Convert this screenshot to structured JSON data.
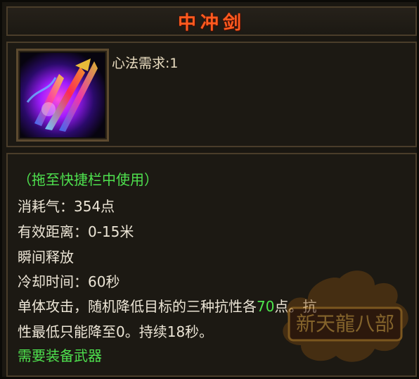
{
  "skill": {
    "name": "中冲剑",
    "requirement": "心法需求:1",
    "icon": "sword-qi-skill-icon",
    "usage_hint": "（拖至快捷栏中使用）",
    "cost": "消耗气：354点",
    "range": "有效距离：0-15米",
    "cast_type": "瞬间释放",
    "cooldown": "冷却时间：60秒",
    "desc_line1_prefix": "单体攻击，随机降低目标的三种抗性各",
    "desc_line1_value": "70",
    "desc_line1_suffix": "点。抗",
    "desc_line2": "性最低只能降至0。持续18秒。",
    "weapon_req": "需要装备武器"
  },
  "watermark": {
    "label": "新天龍八部"
  },
  "colors": {
    "title": "#ff5a1f",
    "green": "#4de64d",
    "text": "#ece5d6",
    "border": "#4a3d2a"
  }
}
